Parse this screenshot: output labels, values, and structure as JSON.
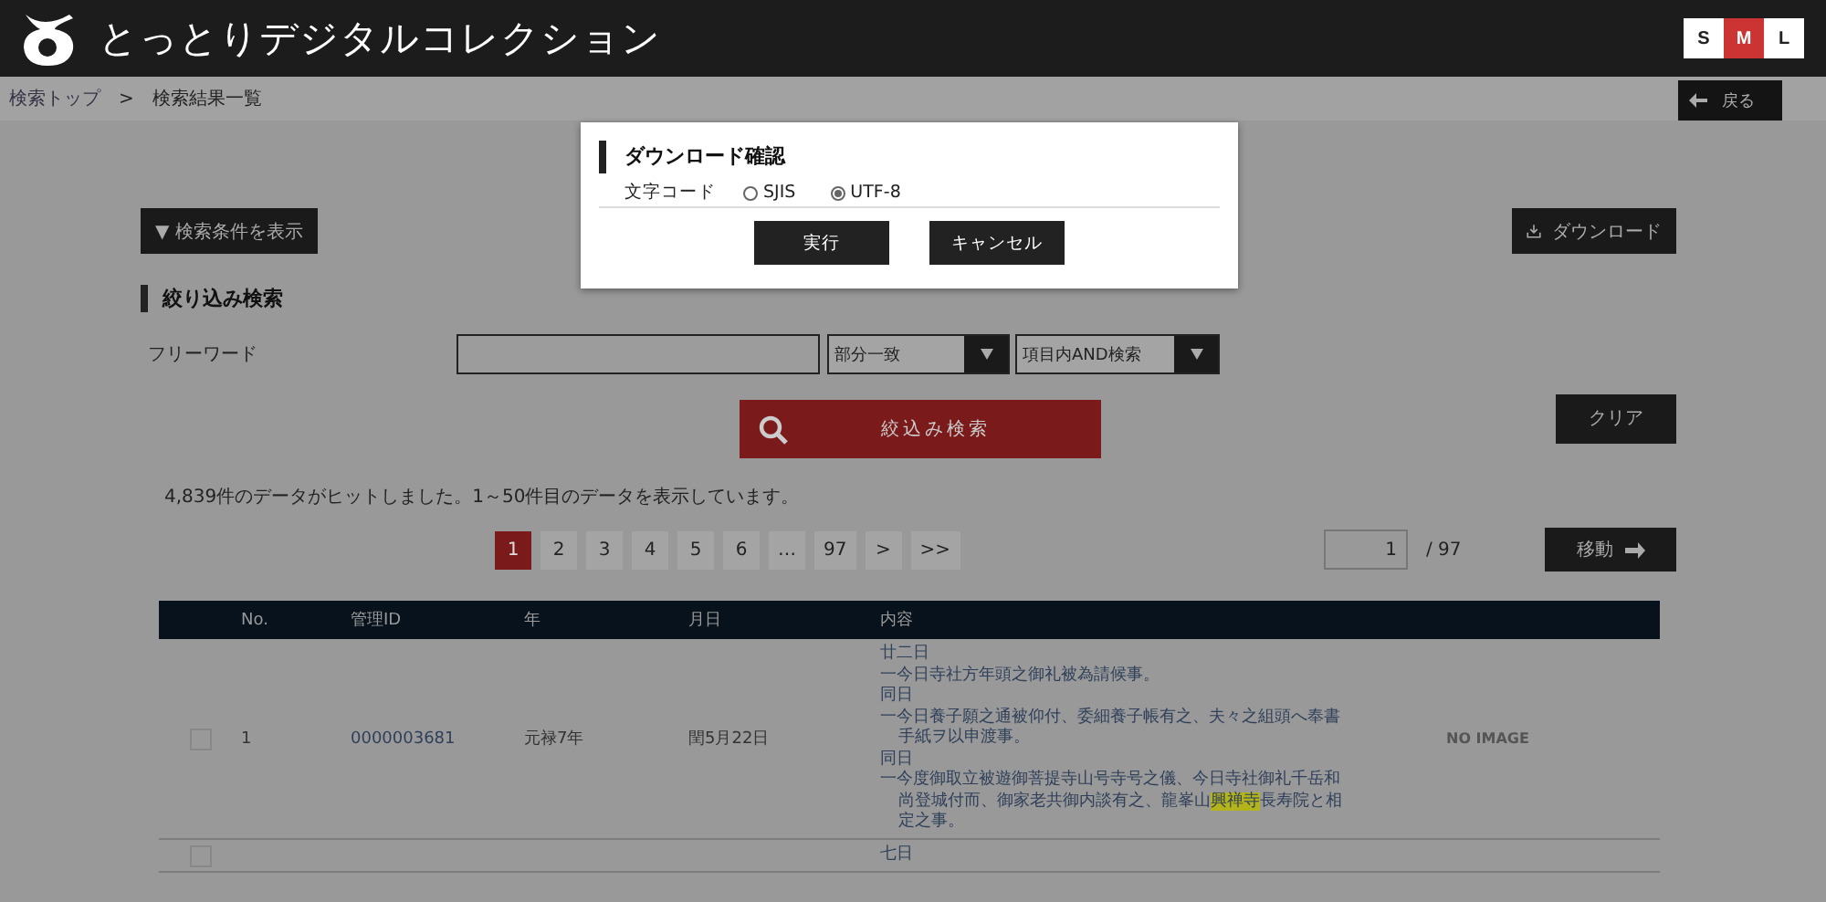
{
  "header": {
    "title": "とっとりデジタルコレクション",
    "font_sizes": [
      {
        "label": "S",
        "selected": false
      },
      {
        "label": "M",
        "selected": true
      },
      {
        "label": "L",
        "selected": false
      }
    ]
  },
  "breadcrumb": {
    "items": [
      "検索トップ",
      ">",
      "検索結果一覧"
    ],
    "back_button": "戻る"
  },
  "toolbar": {
    "show_conditions": "▼ 検索条件を表示",
    "download": "ダウンロード"
  },
  "refine": {
    "heading": "絞り込み検索",
    "free_word_label": "フリーワード",
    "match_select": "部分一致",
    "mode_select": "項目内AND検索",
    "search_button": "絞込み検索",
    "clear_button": "クリア"
  },
  "result_summary": "4,839件のデータがヒットしました。1～50件目のデータを表示しています。",
  "pagination": {
    "pages": [
      {
        "label": "1",
        "selected": true
      },
      {
        "label": "2",
        "selected": false
      },
      {
        "label": "3",
        "selected": false
      },
      {
        "label": "4",
        "selected": false
      },
      {
        "label": "5",
        "selected": false
      },
      {
        "label": "6",
        "selected": false
      },
      {
        "label": "…",
        "selected": false
      },
      {
        "label": "97",
        "selected": false
      },
      {
        "label": ">",
        "selected": false
      },
      {
        "label": ">>",
        "selected": false
      }
    ],
    "page_input": "1",
    "total": "/ 97",
    "go_button": "移動"
  },
  "table": {
    "columns": [
      "No.",
      "管理ID",
      "年",
      "月日",
      "内容"
    ],
    "rows": [
      {
        "checked": false,
        "no": "1",
        "id": "0000003681",
        "year": "元禄7年",
        "date": "閏5月22日",
        "image": "NO IMAGE",
        "lines": [
          {
            "indent": false,
            "parts": [
              {
                "text": "廿二日",
                "highlight": false
              }
            ]
          },
          {
            "indent": false,
            "parts": [
              {
                "text": "一今日寺社方年頭之御礼被為請候事。",
                "highlight": false
              }
            ]
          },
          {
            "indent": false,
            "parts": [
              {
                "text": "同日",
                "highlight": false
              }
            ]
          },
          {
            "indent": false,
            "parts": [
              {
                "text": "一今日養子願之通被仰付、委細養子帳有之、夫々之組頭へ奉書",
                "highlight": false
              }
            ]
          },
          {
            "indent": true,
            "parts": [
              {
                "text": "手紙ヲ以申渡事。",
                "highlight": false
              }
            ]
          },
          {
            "indent": false,
            "parts": [
              {
                "text": "同日",
                "highlight": false
              }
            ]
          },
          {
            "indent": false,
            "parts": [
              {
                "text": "一今度御取立被遊御菩提寺山号寺号之儀、今日寺社御礼千岳和",
                "highlight": false
              }
            ]
          },
          {
            "indent": true,
            "parts": [
              {
                "text": "尚登城付而、御家老共御内談有之、龍峯山",
                "highlight": false
              },
              {
                "text": "興禅寺",
                "highlight": true
              },
              {
                "text": "長寿院と相",
                "highlight": false
              }
            ]
          },
          {
            "indent": true,
            "parts": [
              {
                "text": "定之事。",
                "highlight": false
              }
            ]
          }
        ]
      },
      {
        "checked": false,
        "lines": [
          {
            "indent": false,
            "parts": [
              {
                "text": "七日",
                "highlight": false
              }
            ]
          }
        ]
      }
    ]
  },
  "dialog": {
    "title": "ダウンロード確認",
    "encoding_label": "文字コード",
    "encodings": [
      {
        "label": "SJIS",
        "selected": false
      },
      {
        "label": "UTF-8",
        "selected": true
      }
    ],
    "ok_button": "実行",
    "cancel_button": "キャンセル"
  }
}
